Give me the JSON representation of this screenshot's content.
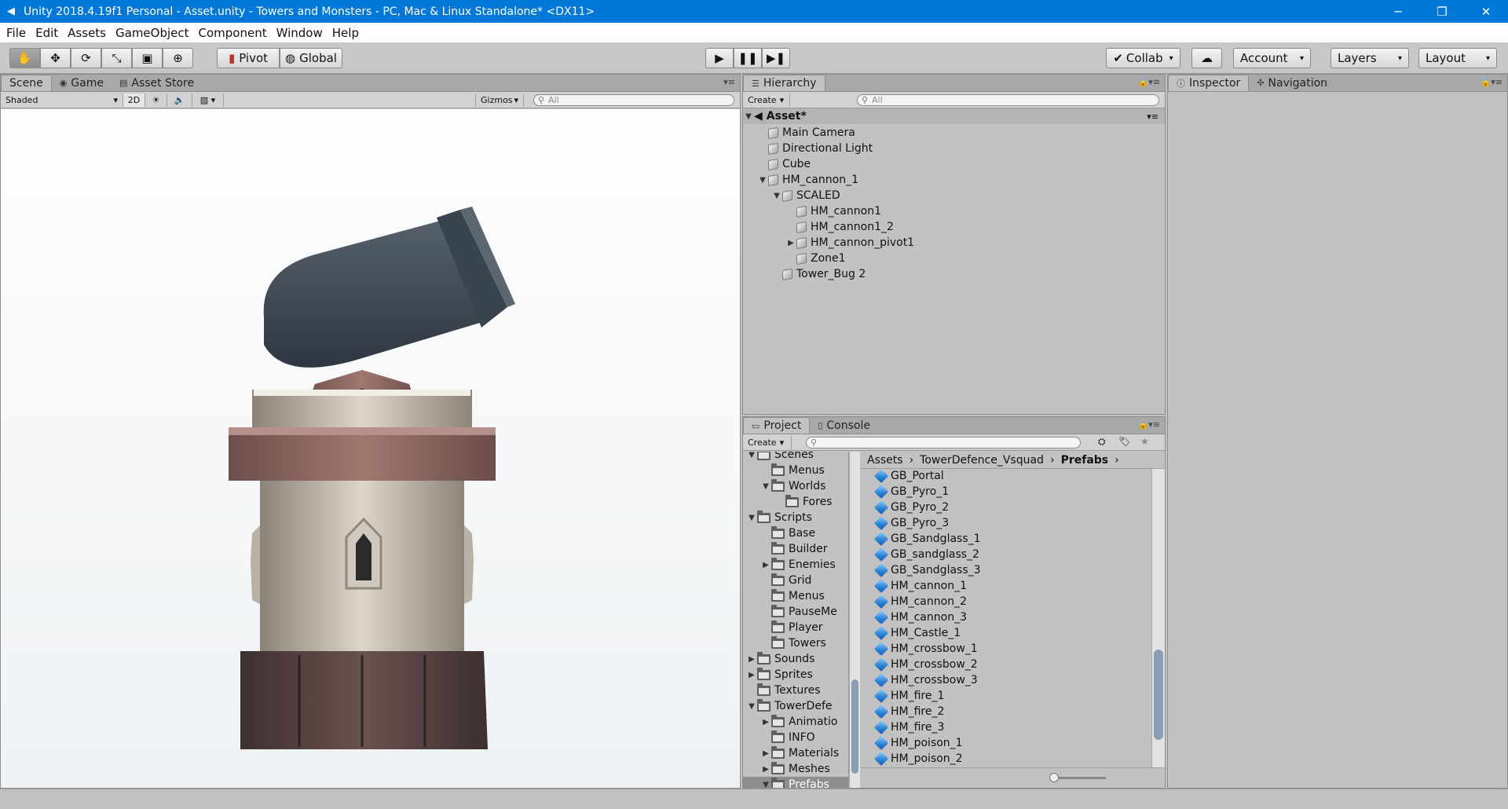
{
  "window": {
    "title": "Unity 2018.4.19f1 Personal - Asset.unity - Towers and Monsters - PC, Mac & Linux Standalone* <DX11>",
    "minimize": "─",
    "maximize": "❐",
    "close": "✕"
  },
  "menu": [
    "File",
    "Edit",
    "Assets",
    "GameObject",
    "Component",
    "Window",
    "Help"
  ],
  "toolbar": {
    "pivot": "Pivot",
    "global": "Global",
    "collab": "Collab",
    "account": "Account",
    "layers": "Layers",
    "layout": "Layout"
  },
  "scene": {
    "tabs": [
      "Scene",
      "Game",
      "Asset Store"
    ],
    "shading": "Shaded",
    "mode2d": "2D",
    "gizmos": "Gizmos",
    "search_placeholder": "All"
  },
  "hierarchy": {
    "tab": "Hierarchy",
    "create": "Create",
    "search_placeholder": "All",
    "scene_name": "Asset*",
    "items": [
      {
        "label": "Main Camera",
        "depth": 0,
        "arrow": ""
      },
      {
        "label": "Directional Light",
        "depth": 0,
        "arrow": ""
      },
      {
        "label": "Cube",
        "depth": 0,
        "arrow": ""
      },
      {
        "label": "HM_cannon_1",
        "depth": 0,
        "arrow": "▼"
      },
      {
        "label": "SCALED",
        "depth": 1,
        "arrow": "▼"
      },
      {
        "label": "HM_cannon1",
        "depth": 2,
        "arrow": ""
      },
      {
        "label": "HM_cannon1_2",
        "depth": 2,
        "arrow": ""
      },
      {
        "label": "HM_cannon_pivot1",
        "depth": 2,
        "arrow": "▶"
      },
      {
        "label": "Zone1",
        "depth": 2,
        "arrow": ""
      },
      {
        "label": "Tower_Bug 2",
        "depth": 1,
        "arrow": ""
      }
    ]
  },
  "inspector": {
    "tabs": [
      "Inspector",
      "Navigation"
    ]
  },
  "project": {
    "tabs": [
      "Project",
      "Console"
    ],
    "create": "Create",
    "breadcrumb": [
      "Assets",
      "TowerDefence_Vsquad",
      "Prefabs"
    ],
    "folders": [
      {
        "label": "Scenes",
        "depth": 1,
        "arrow": "▼"
      },
      {
        "label": "Menus",
        "depth": 2,
        "arrow": ""
      },
      {
        "label": "Worlds",
        "depth": 2,
        "arrow": "▼"
      },
      {
        "label": "Fores",
        "depth": 3,
        "arrow": ""
      },
      {
        "label": "Scripts",
        "depth": 1,
        "arrow": "▼"
      },
      {
        "label": "Base",
        "depth": 2,
        "arrow": ""
      },
      {
        "label": "Builder",
        "depth": 2,
        "arrow": ""
      },
      {
        "label": "Enemies",
        "depth": 2,
        "arrow": "▶"
      },
      {
        "label": "Grid",
        "depth": 2,
        "arrow": ""
      },
      {
        "label": "Menus",
        "depth": 2,
        "arrow": ""
      },
      {
        "label": "PauseMe",
        "depth": 2,
        "arrow": ""
      },
      {
        "label": "Player",
        "depth": 2,
        "arrow": ""
      },
      {
        "label": "Towers",
        "depth": 2,
        "arrow": ""
      },
      {
        "label": "Sounds",
        "depth": 1,
        "arrow": "▶"
      },
      {
        "label": "Sprites",
        "depth": 1,
        "arrow": "▶"
      },
      {
        "label": "Textures",
        "depth": 1,
        "arrow": ""
      },
      {
        "label": "TowerDefe",
        "depth": 1,
        "arrow": "▼"
      },
      {
        "label": "Animatio",
        "depth": 2,
        "arrow": "▶"
      },
      {
        "label": "INFO",
        "depth": 2,
        "arrow": ""
      },
      {
        "label": "Materials",
        "depth": 2,
        "arrow": "▶"
      },
      {
        "label": "Meshes",
        "depth": 2,
        "arrow": "▶"
      },
      {
        "label": "Prefabs",
        "depth": 2,
        "arrow": "▼",
        "selected": true
      }
    ],
    "assets": [
      "GB_Portal",
      "GB_Pyro_1",
      "GB_Pyro_2",
      "GB_Pyro_3",
      "GB_Sandglass_1",
      "GB_sandglass_2",
      "GB_Sandglass_3",
      "HM_cannon_1",
      "HM_cannon_2",
      "HM_cannon_3",
      "HM_Castle_1",
      "HM_crossbow_1",
      "HM_crossbow_2",
      "HM_crossbow_3",
      "HM_fire_1",
      "HM_fire_2",
      "HM_fire_3",
      "HM_poison_1",
      "HM_poison_2"
    ]
  }
}
